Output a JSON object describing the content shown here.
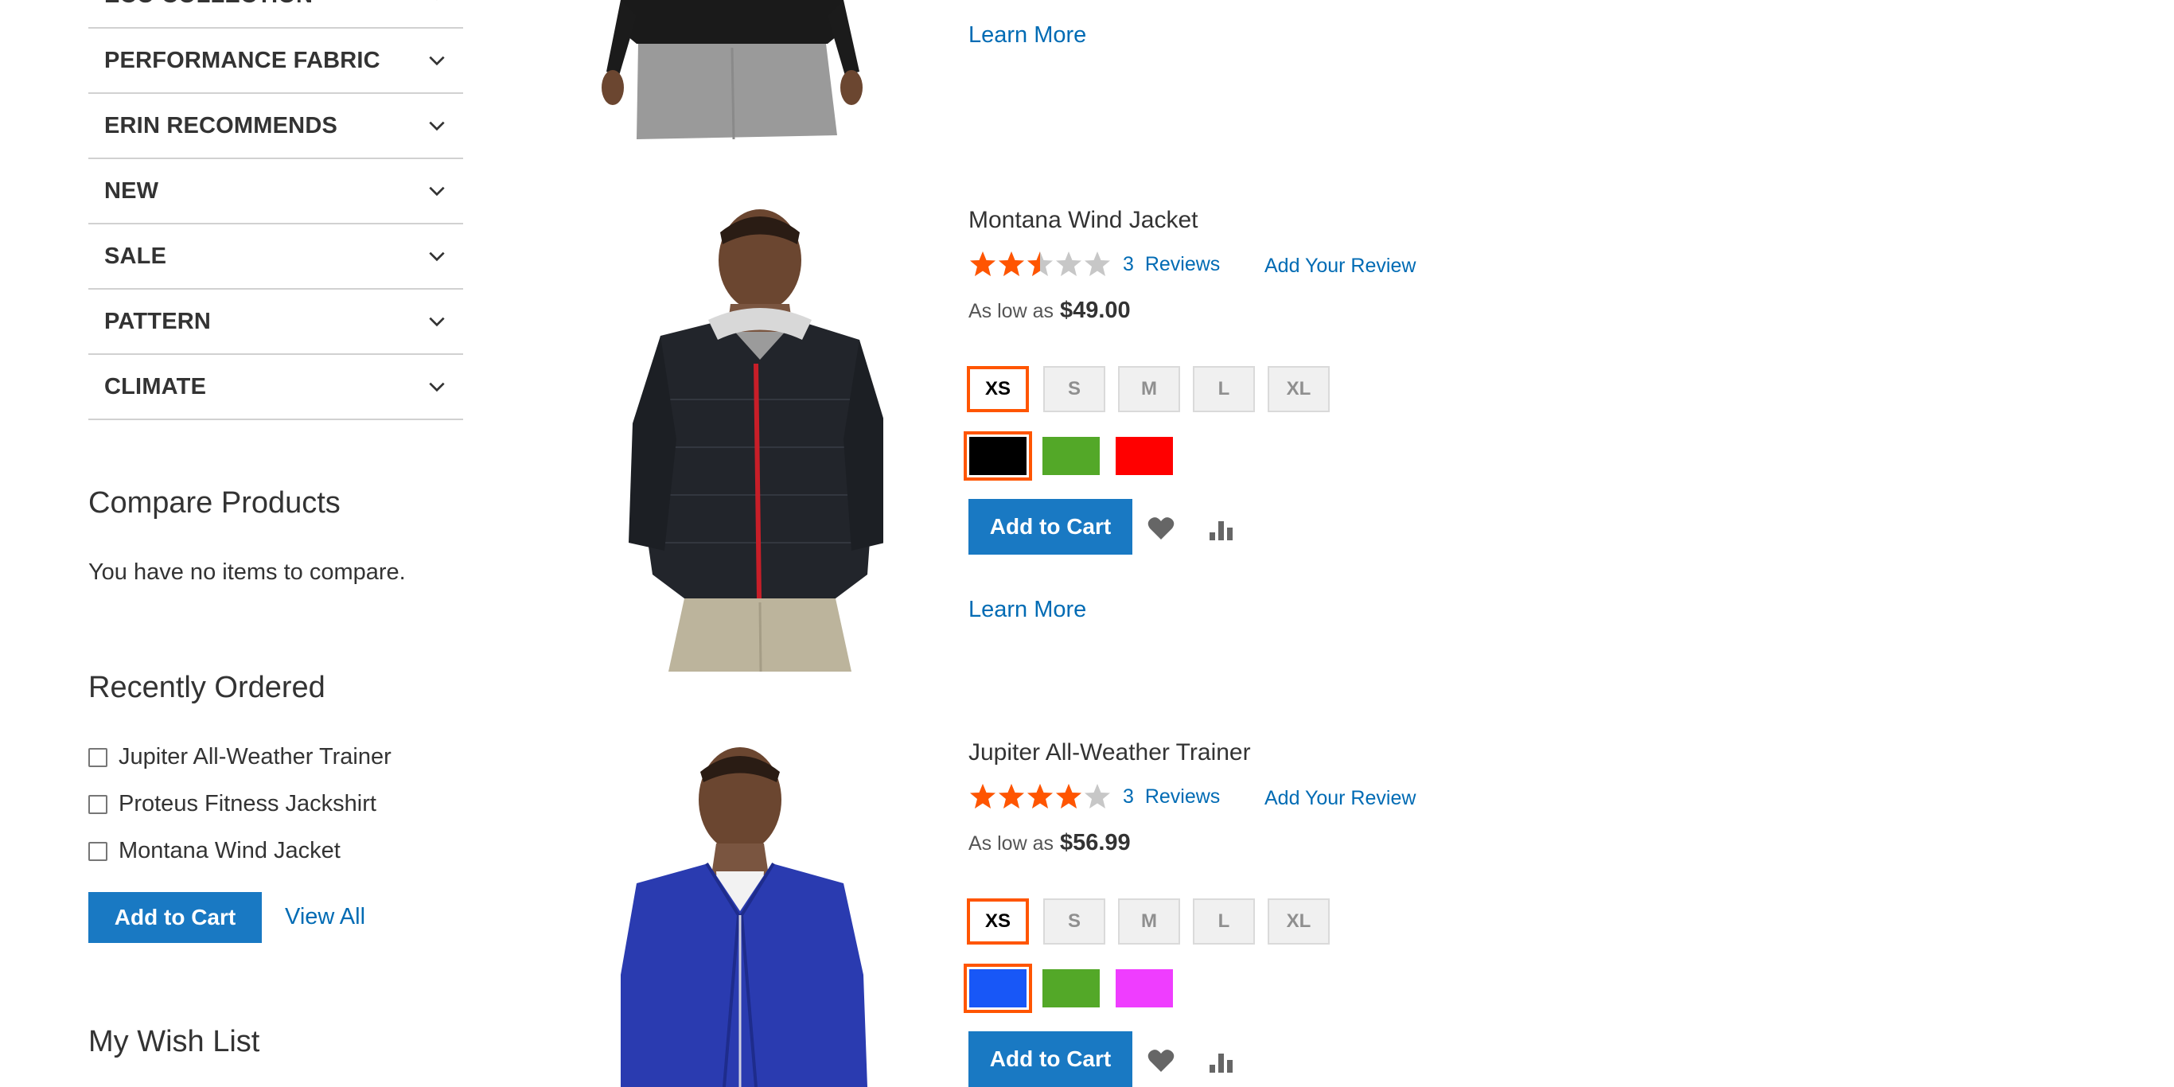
{
  "sidebar": {
    "filters": [
      {
        "label": "ECO COLLECTION"
      },
      {
        "label": "PERFORMANCE FABRIC"
      },
      {
        "label": "ERIN RECOMMENDS"
      },
      {
        "label": "NEW"
      },
      {
        "label": "SALE"
      },
      {
        "label": "PATTERN"
      },
      {
        "label": "CLIMATE"
      }
    ],
    "compare": {
      "title": "Compare Products",
      "empty_text": "You have no items to compare."
    },
    "recently_ordered": {
      "title": "Recently Ordered",
      "items": [
        "Jupiter All-Weather Trainer",
        "Proteus Fitness Jackshirt",
        "Montana Wind Jacket"
      ],
      "add_to_cart_label": "Add to Cart",
      "view_all_label": "View All"
    },
    "wishlist": {
      "title": "My Wish List"
    }
  },
  "products": [
    {
      "learn_more": "Learn More"
    },
    {
      "name": "Montana Wind Jacket",
      "rating_percent": 50,
      "reviews_count": "3",
      "reviews_label": "Reviews",
      "add_review": "Add Your Review",
      "price_prefix": "As low as",
      "price": "$49.00",
      "sizes": [
        "XS",
        "S",
        "M",
        "L",
        "XL"
      ],
      "selected_size": "XS",
      "colors": [
        "#000000",
        "#53a828",
        "#ff0000"
      ],
      "selected_color": 0,
      "add_to_cart": "Add to Cart",
      "learn_more": "Learn More"
    },
    {
      "name": "Jupiter All-Weather Trainer",
      "rating_percent": 80,
      "reviews_count": "3",
      "reviews_label": "Reviews",
      "add_review": "Add Your Review",
      "price_prefix": "As low as",
      "price": "$56.99",
      "sizes": [
        "XS",
        "S",
        "M",
        "L",
        "XL"
      ],
      "selected_size": "XS",
      "colors": [
        "#1857f7",
        "#53a828",
        "#ef3dff"
      ],
      "selected_color": 0,
      "add_to_cart": "Add to Cart"
    }
  ],
  "colors": {
    "accent": "#1979c3",
    "link": "#006bb4",
    "star_filled": "#ff5501",
    "star_empty": "#c7c7c7",
    "selected_outline": "#ff5501"
  }
}
